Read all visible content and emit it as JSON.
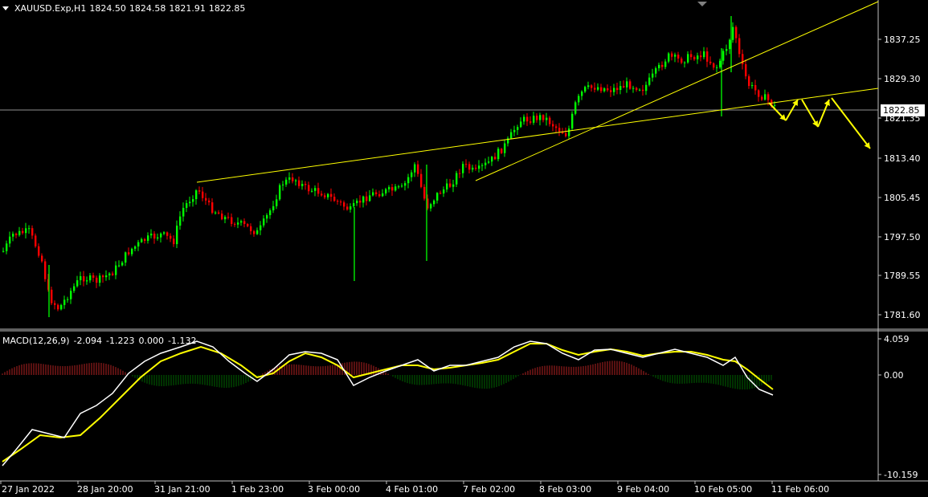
{
  "header": {
    "symbol": "XAUUSD.Exp,H1",
    "open": "1824.50",
    "high": "1824.58",
    "low": "1821.91",
    "close": "1822.85"
  },
  "current_price": "1822.85",
  "price_axis": {
    "min": 1778,
    "max": 1843,
    "labels": [
      "1837.25",
      "1829.30",
      "1821.35",
      "1813.40",
      "1805.45",
      "1797.50",
      "1789.55",
      "1781.60"
    ]
  },
  "macd": {
    "label": "MACD(12,26,9)",
    "values": [
      "-2.094",
      "-1.223",
      "0.000",
      "-1.132"
    ],
    "axis_labels": [
      "4.059",
      "0.00",
      "-10.159"
    ],
    "range": [
      -10.159,
      4.059
    ]
  },
  "time_axis": [
    "27 Jan 2022",
    "28 Jan 20:00",
    "31 Jan 21:00",
    "1 Feb 23:00",
    "3 Feb 00:00",
    "4 Feb 01:00",
    "7 Feb 02:00",
    "8 Feb 03:00",
    "9 Feb 04:00",
    "10 Feb 05:00",
    "11 Feb 06:00"
  ],
  "colors": {
    "background": "#000000",
    "bull": "#00ff00",
    "bear": "#ff0000",
    "trendline": "#ffff00",
    "grid": "#c0c0c0",
    "macd_line": "#ffffff",
    "signal_line": "#ffff00",
    "hist_pos": "#b22222",
    "hist_neg": "#006400"
  }
}
